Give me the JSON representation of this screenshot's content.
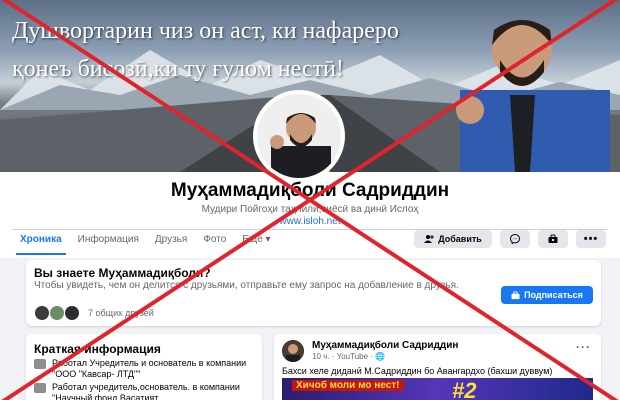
{
  "cover": {
    "line1": "Душвортарин чиз он аст, ки нафареро",
    "line2": "қонеъ бисозӣ,ки ту ғулом нестӣ!"
  },
  "profile": {
    "name": "Муҳаммадиқболи Садриддин",
    "bio": "Мудири Пойгоҳи таҳлилӣ,сиёсӣ ва динӣ Ислоҳ",
    "website": "www.isloh.net"
  },
  "tabs": [
    {
      "label": "Хроника"
    },
    {
      "label": "Информация"
    },
    {
      "label": "Друзья"
    },
    {
      "label": "Фото"
    },
    {
      "label": "Ещё"
    }
  ],
  "actions": {
    "add_friend": "Добавить",
    "messenger_icon": "messenger-icon",
    "subscribe_icon": "subscribe-icon",
    "more_icon": "more-icon"
  },
  "suggestion": {
    "title": "Вы знаете Муҳаммадиқболи?",
    "description": "Чтобы увидеть, чем он делится с друзьями, отправьте ему запрос на добавление в друзья.",
    "mutual_friends": "7 общих друзей",
    "subscribe_label": "Подписаться"
  },
  "intro": {
    "heading": "Краткая информация",
    "items": [
      {
        "text": "Работал Учредитель и основатель в компании \"ООО \"Кавсар- ЛТД\"\""
      },
      {
        "text": "Работал учредитель,основатель. в компании \"Научный фонд Васатият"
      }
    ]
  },
  "post": {
    "author": "Муҳаммадиқболи Садриддин",
    "meta": "10 ч. · YouTube · ",
    "text": "Бахси хеле диданӣ М.Садриддин бо Авангардхо (бахши дуввум)",
    "thumb_caption": "Хичоб моли мо нест!",
    "thumb_number": "#2"
  },
  "colors": {
    "accent": "#1877f2",
    "cross": "#e0242c"
  }
}
